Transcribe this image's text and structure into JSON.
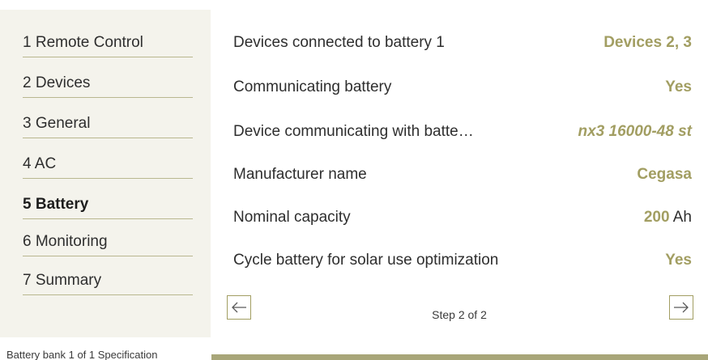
{
  "sidebar": {
    "items": [
      {
        "label": "1 Remote Control",
        "active": false
      },
      {
        "label": "2 Devices",
        "active": false
      },
      {
        "label": "3 General",
        "active": false
      },
      {
        "label": "4 AC",
        "active": false
      },
      {
        "label": "5 Battery",
        "active": true
      },
      {
        "label": "6 Monitoring",
        "active": false
      },
      {
        "label": "7 Summary",
        "active": false
      }
    ]
  },
  "main": {
    "rows": [
      {
        "label": "Devices connected to battery 1",
        "value": "Devices 2, 3",
        "unit": ""
      },
      {
        "label": "Communicating battery",
        "value": "Yes",
        "unit": ""
      },
      {
        "label": "Device communicating with batte…",
        "value": "nx3 16000-48 st",
        "unit": ""
      },
      {
        "label": "Manufacturer name",
        "value": "Cegasa",
        "unit": ""
      },
      {
        "label": "Nominal capacity",
        "value": "200",
        "unit": "Ah"
      },
      {
        "label": "Cycle battery for solar use optimization",
        "value": "Yes",
        "unit": ""
      }
    ],
    "step_text": "Step 2 of 2"
  },
  "footer": {
    "caption": "Battery bank 1 of 1 Specification"
  },
  "colors": {
    "accent": "#a29e62",
    "sidebar_bg": "#f4f3ec",
    "footer_bar": "#a8a679"
  },
  "icons": {
    "prev": "arrow-left-icon",
    "next": "arrow-right-icon"
  }
}
